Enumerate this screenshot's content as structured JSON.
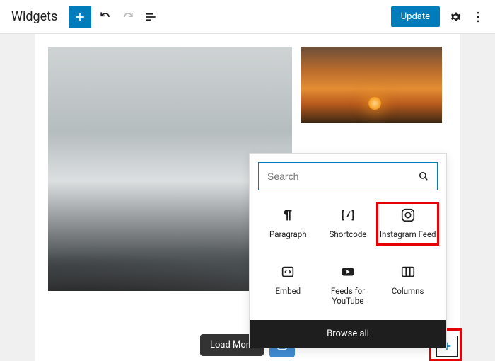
{
  "topbar": {
    "title": "Widgets",
    "update": "Update"
  },
  "footer": {
    "load_more": "Load More"
  },
  "inserter": {
    "search_placeholder": "Search",
    "browse_all": "Browse all",
    "blocks": [
      {
        "label": "Paragraph"
      },
      {
        "label": "Shortcode"
      },
      {
        "label": "Instagram Feed"
      },
      {
        "label": "Embed"
      },
      {
        "label": "Feeds for YouTube"
      },
      {
        "label": "Columns"
      }
    ]
  }
}
